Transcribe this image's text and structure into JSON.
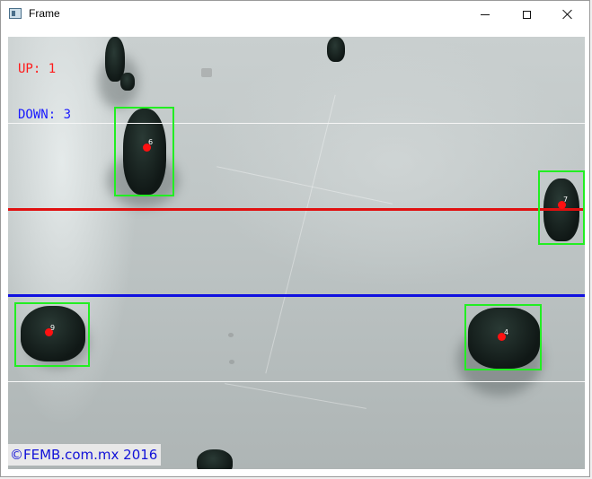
{
  "window": {
    "title": "Frame",
    "icon": "window-app-icon",
    "controls": [
      "minimize-icon",
      "maximize-icon",
      "close-icon"
    ]
  },
  "overlay": {
    "up_text": "UP: 1",
    "down_text": "DOWN: 3",
    "watermark": "©FEMB.com.mx 2016",
    "line_colors": {
      "limit_lines": "#ffffff",
      "up_line": "#e01010",
      "down_line": "#1010e0"
    },
    "box_color": "#22ee22",
    "centroid_color": "#ff1111"
  },
  "tracks": [
    {
      "id": "6"
    },
    {
      "id": "7"
    },
    {
      "id": "9"
    },
    {
      "id": "4"
    }
  ]
}
